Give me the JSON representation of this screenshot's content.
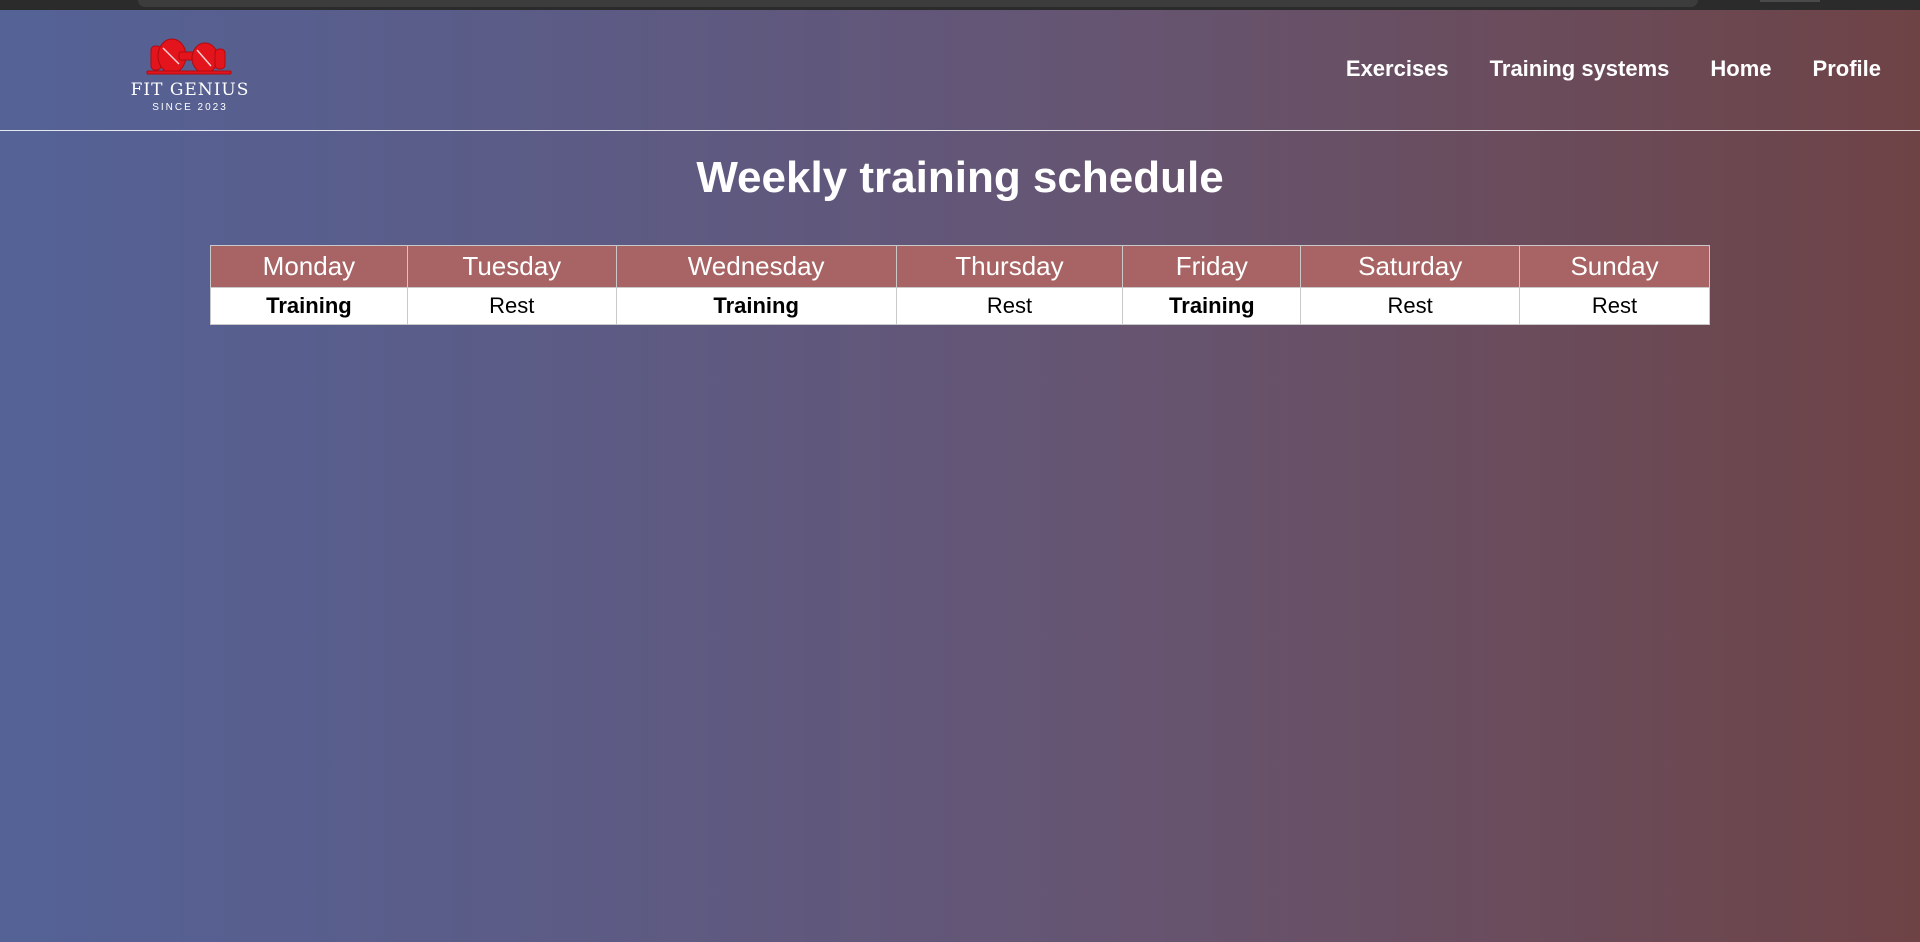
{
  "header": {
    "logo_text": "FIT GENIUS",
    "logo_subtext": "SINCE 2023",
    "nav": [
      {
        "label": "Exercises"
      },
      {
        "label": "Training systems"
      },
      {
        "label": "Home"
      },
      {
        "label": "Profile"
      }
    ]
  },
  "main": {
    "title": "Weekly training schedule",
    "schedule": {
      "days": [
        "Monday",
        "Tuesday",
        "Wednesday",
        "Thursday",
        "Friday",
        "Saturday",
        "Sunday"
      ],
      "activities": [
        "Training",
        "Rest",
        "Training",
        "Rest",
        "Training",
        "Rest",
        "Rest"
      ]
    }
  },
  "colors": {
    "header_cell": "#a86464",
    "logo_accent": "#e3141c",
    "gradient_left": "#546296",
    "gradient_right": "#6e4346"
  },
  "icons": {
    "logo": "dumbbell-icon"
  }
}
